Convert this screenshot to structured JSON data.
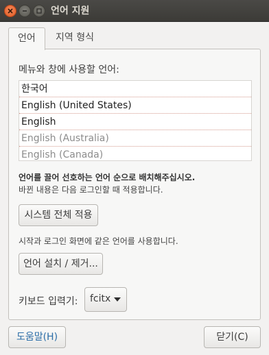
{
  "window": {
    "title": "언어 지원"
  },
  "tabs": [
    {
      "label": "언어",
      "active": true
    },
    {
      "label": "지역 형식",
      "active": false
    }
  ],
  "language_panel": {
    "list_label": "메뉴와 창에 사용할 언어:",
    "languages": [
      {
        "name": "한국어",
        "dim": false
      },
      {
        "name": "English (United States)",
        "dim": false
      },
      {
        "name": "English",
        "dim": false
      },
      {
        "name": "English (Australia)",
        "dim": true
      },
      {
        "name": "English (Canada)",
        "dim": true
      }
    ],
    "drag_hint": "언어를 끌어 선호하는 언어 순으로 배치해주십시오.",
    "change_hint": "바뀐 내용은 다음 로그인할 때 적용합니다.",
    "apply_system_button": "시스템 전체 적용",
    "login_hint": "시작과 로그인 화면에 같은 언어를 사용합니다.",
    "install_button": "언어 설치 / 제거...",
    "keyboard_label": "키보드 입력기:",
    "keyboard_value": "fcitx"
  },
  "footer": {
    "help_button": "도움말(H)",
    "close_button": "닫기(C)"
  },
  "colors": {
    "titlebar": "#3c3b37",
    "close_button": "#e05a20",
    "help_link": "#2c6ea8"
  }
}
